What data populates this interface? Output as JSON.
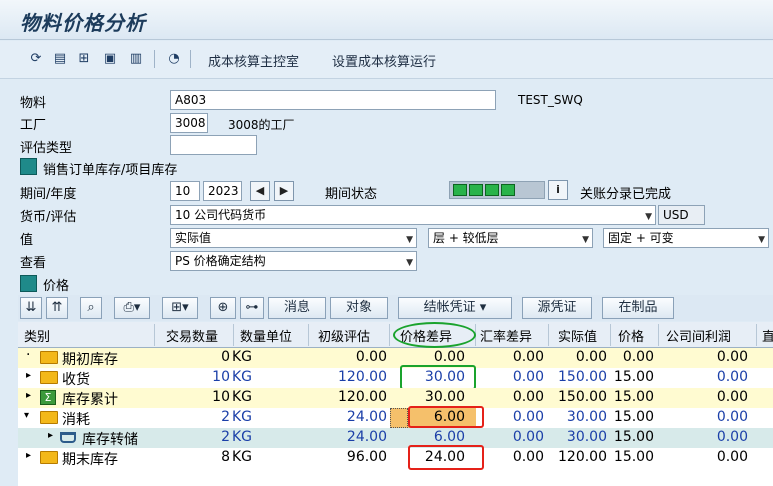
{
  "window": {
    "title": "物料价格分析"
  },
  "toolbar": {
    "cost_cockpit_label": "成本核算主控室",
    "set_costing_run_label": "设置成本核算运行"
  },
  "form": {
    "material_label": "物料",
    "material_value": "A803",
    "material_desc": "TEST_SWQ",
    "plant_label": "工厂",
    "plant_value": "3008",
    "plant_desc": "3008的工厂",
    "valuation_type_label": "评估类型",
    "valuation_type_value": "",
    "sales_order_stock_label": "销售订单库存/项目库存",
    "period_label": "期间/年度",
    "period_value": "10",
    "year_value": "2023",
    "period_status_label": "期间状态",
    "period_status_text": "关账分录已完成",
    "currency_label": "货币/评估",
    "currency_value": "10 公司代码货币",
    "currency_code": "USD",
    "value_label": "值",
    "value_option": "实际值",
    "layer_option": "层 + 较低层",
    "fixed_option": "固定 + 可变",
    "view_label": "查看",
    "view_option": "PS 价格确定结构"
  },
  "price_section_label": "价格",
  "grid_buttons": {
    "messages": "消息",
    "objects": "对象",
    "settlement": "结帐凭证",
    "source_doc": "源凭证",
    "wip": "在制品"
  },
  "grid": {
    "headers": [
      "类别",
      "交易数量",
      "数量单位",
      "初级评估",
      "价格差异",
      "汇率差异",
      "实际值",
      "价格",
      "公司间利润",
      "直"
    ],
    "rows": [
      {
        "category": "期初库存",
        "qty": "0",
        "unit": "KG",
        "primary": "0.00",
        "price_diff": "0.00",
        "fx_diff": "0.00",
        "actual": "0.00",
        "price": "0.00",
        "ic_profit": "0.00"
      },
      {
        "category": "收货",
        "qty": "10",
        "unit": "KG",
        "primary": "120.00",
        "price_diff": "30.00",
        "fx_diff": "0.00",
        "actual": "150.00",
        "price": "15.00",
        "ic_profit": "0.00"
      },
      {
        "category": "库存累计",
        "qty": "10",
        "unit": "KG",
        "primary": "120.00",
        "price_diff": "30.00",
        "fx_diff": "0.00",
        "actual": "150.00",
        "price": "15.00",
        "ic_profit": "0.00"
      },
      {
        "category": "消耗",
        "qty": "2",
        "unit": "KG",
        "primary": "24.00",
        "price_diff": "6.00",
        "fx_diff": "0.00",
        "actual": "30.00",
        "price": "15.00",
        "ic_profit": "0.00"
      },
      {
        "category": "库存转储",
        "qty": "2",
        "unit": "KG",
        "primary": "24.00",
        "price_diff": "6.00",
        "fx_diff": "0.00",
        "actual": "30.00",
        "price": "15.00",
        "ic_profit": "0.00"
      },
      {
        "category": "期末库存",
        "qty": "8",
        "unit": "KG",
        "primary": "96.00",
        "price_diff": "24.00",
        "fx_diff": "0.00",
        "actual": "120.00",
        "price": "15.00",
        "ic_profit": "0.00"
      }
    ]
  },
  "colors": {
    "green_light": "#29b34a",
    "highlight_green": "#1aa32d",
    "highlight_red": "#e52119",
    "row_yellow": "#fffbd1",
    "row_teal": "#d7eaea"
  }
}
